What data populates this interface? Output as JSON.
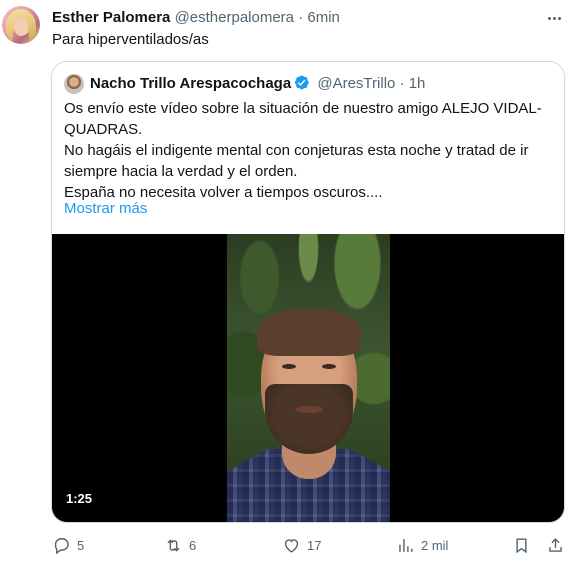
{
  "author": {
    "name": "Esther Palomera",
    "handle": "@estherpalomera",
    "separator": "·",
    "time": "6min"
  },
  "tweet": {
    "text": "Para hiperventilados/as"
  },
  "quote": {
    "name": "Nacho Trillo Arespacochaga",
    "handle": "@AresTrillo",
    "separator": "·",
    "time": "1h",
    "lines": [
      "Os envío este vídeo sobre la situación de nuestro amigo ALEJO VIDAL-QUADRAS.",
      "No hagáis el indigente mental con conjeturas esta noche y tratad de ir siempre hacia la verdad y el orden.",
      "España no necesita volver a tiempos oscuros...."
    ],
    "show_more": "Mostrar más",
    "video_duration": "1:25",
    "verified_color": "#1d9bf0"
  },
  "actions": {
    "replies": "5",
    "retweets": "6",
    "likes": "17",
    "views": "2 mil"
  },
  "icons": [
    "more-icon",
    "verified-icon",
    "reply-icon",
    "retweet-icon",
    "like-icon",
    "views-icon",
    "bookmark-icon",
    "share-icon"
  ]
}
